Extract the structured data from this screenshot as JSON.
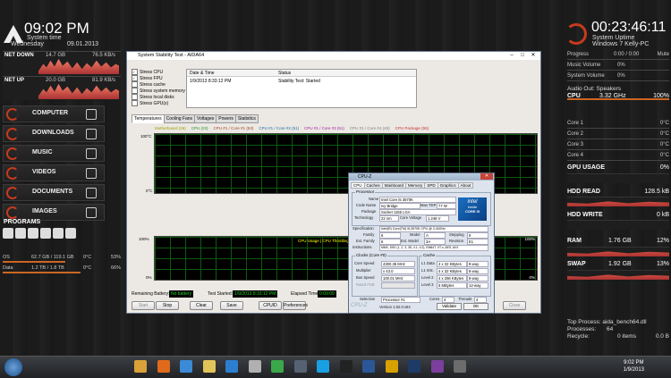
{
  "left_panel": {
    "clock": "09:02 PM",
    "system_time_label": "System time",
    "weekday": "Wednesday",
    "date": "09.01.2013",
    "net_down": {
      "label": "NET DOWN",
      "total": "14.7 GB",
      "rate": "76.5 KB/s"
    },
    "net_up": {
      "label": "NET UP",
      "total": "20.0 GB",
      "rate": "81.9 KB/s"
    },
    "menu": [
      {
        "label": "COMPUTER",
        "icon": "monitor-icon"
      },
      {
        "label": "DOWNLOADS",
        "icon": "download-icon"
      },
      {
        "label": "MUSIC",
        "icon": "headphones-icon"
      },
      {
        "label": "VIDEOS",
        "icon": "video-icon"
      },
      {
        "label": "DOCUMENTS",
        "icon": "document-icon"
      },
      {
        "label": "IMAGES",
        "icon": "image-icon"
      }
    ],
    "programs_label": "PROGRAMS",
    "drives": [
      {
        "name": "OS",
        "size": "62.7 GB / 119.1 GB",
        "temp": "0°C",
        "percent": "53%",
        "fill": 0.53
      },
      {
        "name": "Data",
        "size": "1.2 TB / 1.8 TB",
        "temp": "0°C",
        "percent": "66%",
        "fill": 0.66
      }
    ]
  },
  "right_panel": {
    "uptime": "00:23:46:11",
    "uptime_label": "System Uptime",
    "os_line": "Windows 7  Kelly-PC",
    "progress": {
      "label": "Progress",
      "value": "0:00 / 0:00",
      "extra": "Mute"
    },
    "music_volume": {
      "label": "Music Volume",
      "value": "0%"
    },
    "system_volume": {
      "label": "System Volume",
      "value": "0%"
    },
    "audio_out": "Audio Out: Speakers",
    "cpu": {
      "label": "CPU",
      "freq": "3.32 GHz",
      "percent": "100%",
      "fill": 1.0
    },
    "cores": [
      {
        "label": "Core 1",
        "temp": "0°C"
      },
      {
        "label": "Core 2",
        "temp": "0°C"
      },
      {
        "label": "Core 3",
        "temp": "0°C"
      },
      {
        "label": "Core 4",
        "temp": "0°C"
      }
    ],
    "gpu": {
      "label": "GPU USAGE",
      "value": "0%"
    },
    "hdd_read": {
      "label": "HDD READ",
      "value": "128.5 kB"
    },
    "hdd_write": {
      "label": "HDD WRITE",
      "value": "0 kB"
    },
    "ram": {
      "label": "RAM",
      "value": "1.76 GB",
      "percent": "12%",
      "fill": 0.12
    },
    "swap": {
      "label": "SWAP",
      "value": "1.92 GB",
      "percent": "13%",
      "fill": 0.13
    },
    "top_process": "Top Process:  aida_bench64.dll",
    "processes": {
      "label": "Processes:",
      "value": "64"
    },
    "recycle": {
      "label": "Recycle:",
      "value": "0 items",
      "size": "0.0 B"
    }
  },
  "aida": {
    "title": "System Stability Test - AIDA64",
    "options": [
      "Stress CPU",
      "Stress FPU",
      "Stress cache",
      "Stress system memory",
      "Stress local disks",
      "Stress GPU(s)"
    ],
    "options_checked": [
      true,
      true,
      false,
      false,
      false,
      false
    ],
    "col_date": "Date & Time",
    "col_status": "Status",
    "row_date": "1/9/2013 8:33:12 PM",
    "row_status": "Stability Test: Started",
    "tabs": [
      "Temperatures",
      "Cooling Fans",
      "Voltages",
      "Powers",
      "Statistics"
    ],
    "temp_legend": [
      "Motherboard (26)",
      "CPU (23)",
      "CPU #1 / Core #1 (53)",
      "CPU #1 / Core #2 (51)",
      "CPU #1 / Core #3 (51)",
      "CPU #1 / Core #4 (49)",
      "CPU Package (55)"
    ],
    "temp_y_top": "100°C",
    "temp_y_bottom": "0°C",
    "usage_legend": "CPU Usage | CPU Throttling",
    "usage_y_top": "100%",
    "usage_y_bottom": "0%",
    "usage_right_top": "100%",
    "usage_right_bottom": "0%",
    "remaining_battery_label": "Remaining Battery:",
    "remaining_battery": "No battery",
    "test_started_label": "Test Started:",
    "test_started": "1/9/2013 8:33:12 PM",
    "elapsed_label": "Elapsed Time:",
    "elapsed": "0:09:09",
    "buttons": [
      "Start",
      "Stop",
      "Clear",
      "Save",
      "CPUID",
      "Preferences"
    ],
    "close_label": "Close"
  },
  "cpuz": {
    "title": "CPU-Z",
    "tabs": [
      "CPU",
      "Caches",
      "Mainboard",
      "Memory",
      "SPD",
      "Graphics",
      "About"
    ],
    "processor_group": "Processor",
    "name_label": "Name",
    "name": "Intel Core i5 3570K",
    "code_label": "Code Name",
    "code": "Ivy Bridge",
    "tdp_label": "Max TDP",
    "tdp": "77 W",
    "package_label": "Package",
    "package": "Socket 1155 LGA",
    "tech_label": "Technology",
    "tech": "22 nm",
    "voltage_label": "Core Voltage",
    "voltage": "1.248 V",
    "spec_label": "Specification",
    "spec": "Intel(R) Core(TM) i5-3570K CPU @ 3.40GHz",
    "family_label": "Family",
    "family": "6",
    "model_label": "Model",
    "model": "A",
    "stepping_label": "Stepping",
    "stepping": "9",
    "extfam_label": "Ext. Family",
    "extfam": "6",
    "extmodel_label": "Ext. Model",
    "extmodel": "3A",
    "revision_label": "Revision",
    "revision": "E1",
    "instr_label": "Instructions",
    "instr": "MMX, SSE (1, 2, 3, 3S, 4.1, 4.2), EM64T, VT-x, AES, AVX",
    "clocks_group": "Clocks (Core #0)",
    "core_speed_label": "Core Speed",
    "core_speed": "4300.35 MHz",
    "mult_label": "Multiplier",
    "mult": "x 43.0",
    "bus_label": "Bus Speed",
    "bus": "100.01 MHz",
    "fsb_label": "Rated FSB",
    "fsb": "",
    "cache_group": "Cache",
    "l1d_label": "L1 Data",
    "l1d": "4 x 32 KBytes",
    "l1d_way": "8-way",
    "l1i_label": "L1 Inst.",
    "l1i": "4 x 32 KBytes",
    "l1i_way": "8-way",
    "l2_label": "Level 2",
    "l2": "4 x 256 KBytes",
    "l2_way": "8-way",
    "l3_label": "Level 3",
    "l3": "6 MBytes",
    "l3_way": "12-way",
    "selection_label": "Selection",
    "selection": "Processor #1",
    "cores_label": "Cores",
    "cores": "4",
    "threads_label": "Threads",
    "threads": "4",
    "logo_brand": "intel",
    "logo_line": "inside",
    "logo_model": "CORE i5",
    "footer": "CPU-Z",
    "version": "Version 1.62.0.x64",
    "validate": "Validate",
    "ok": "OK"
  },
  "taskbar": {
    "time": "9:02 PM",
    "date": "1/9/2013",
    "icons": [
      {
        "name": "chrome-icon",
        "color": "#d9a13a"
      },
      {
        "name": "firefox-icon",
        "color": "#e06a1c"
      },
      {
        "name": "ie-icon",
        "color": "#3b8ad8"
      },
      {
        "name": "explorer-icon",
        "color": "#e2c35a"
      },
      {
        "name": "media-player-icon",
        "color": "#2c7fd0"
      },
      {
        "name": "settings-icon",
        "color": "#b0b0b0"
      },
      {
        "name": "torrent-icon",
        "color": "#3aa84a"
      },
      {
        "name": "steam-icon",
        "color": "#566273"
      },
      {
        "name": "skype-icon",
        "color": "#19a0e3"
      },
      {
        "name": "aida-icon",
        "color": "#222222"
      },
      {
        "name": "word-icon",
        "color": "#2b5797"
      },
      {
        "name": "winamp-icon",
        "color": "#d8a000"
      },
      {
        "name": "photoshop-icon",
        "color": "#1d3b66"
      },
      {
        "name": "cpuz-icon",
        "color": "#7c3f9e"
      },
      {
        "name": "monitor-icon",
        "color": "#6c6c6c"
      }
    ]
  },
  "colors": {
    "accent": "#c83a1c",
    "graph_green": "#0e5a0e"
  }
}
